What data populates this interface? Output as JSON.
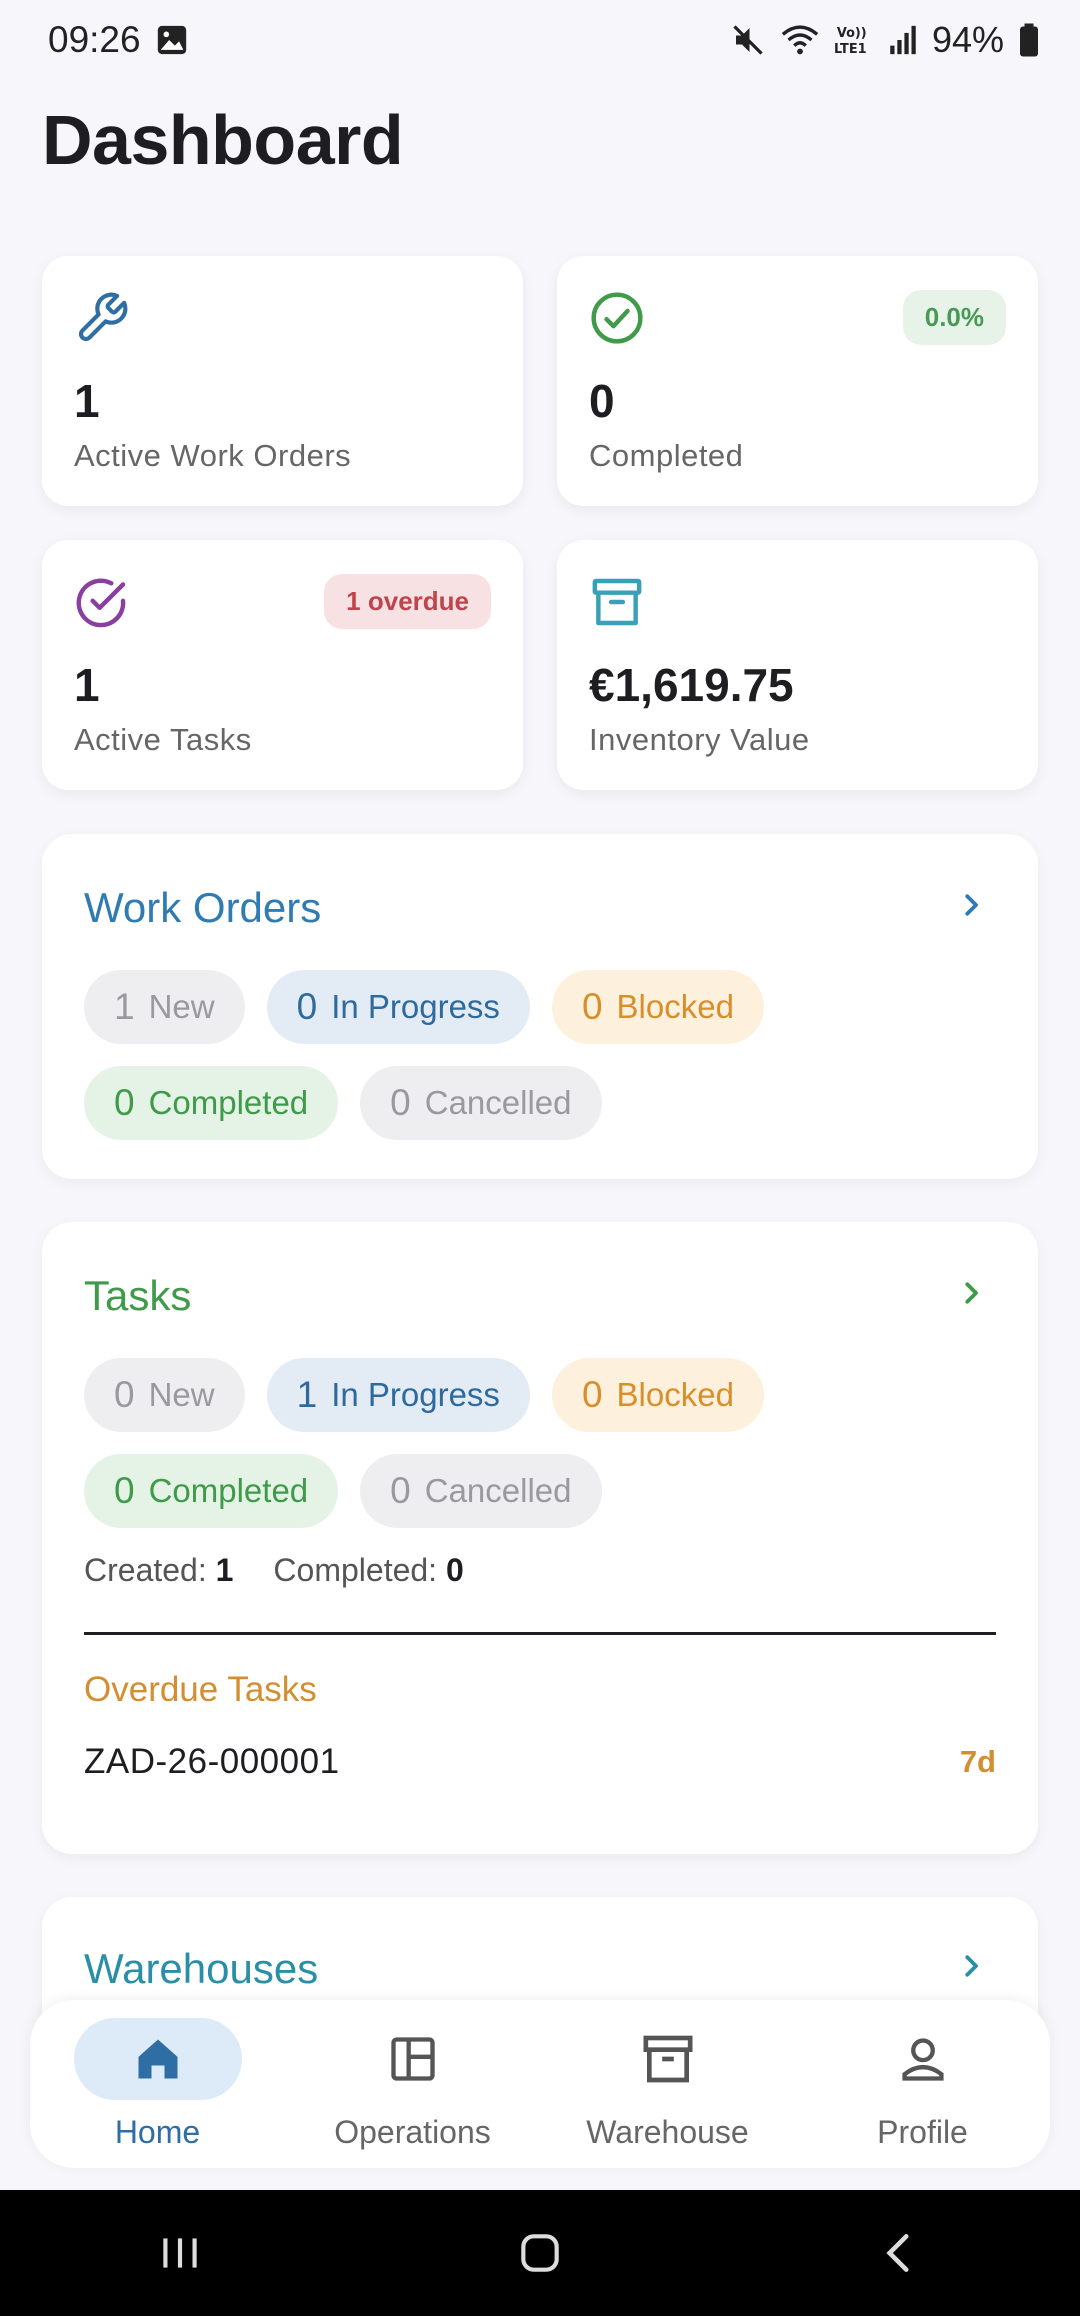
{
  "status_bar": {
    "time": "09:26",
    "battery": "94%",
    "icons": [
      "gallery-icon",
      "mute-icon",
      "wifi-icon",
      "volte-icon",
      "signal-icon",
      "battery-icon"
    ]
  },
  "page": {
    "title": "Dashboard"
  },
  "stats": {
    "work_orders": {
      "icon": "wrench-icon",
      "value": "1",
      "label": "Active Work Orders",
      "color": "#2f6ea5"
    },
    "completed": {
      "icon": "check-circle-icon",
      "value": "0",
      "label": "Completed",
      "badge": "0.0%",
      "color": "#3f9a4a"
    },
    "tasks": {
      "icon": "task-check-icon",
      "value": "1",
      "label": "Active Tasks",
      "badge": "1 overdue",
      "color": "#8a3fa0"
    },
    "inventory": {
      "icon": "archive-icon",
      "value": "€1,619.75",
      "label": "Inventory Value",
      "color": "#3aa0b8"
    }
  },
  "work_orders_section": {
    "title": "Work Orders",
    "color": "#2f7bb3",
    "chips": [
      {
        "num": "1",
        "label": "New",
        "style": "gray"
      },
      {
        "num": "0",
        "label": "In Progress",
        "style": "blue"
      },
      {
        "num": "0",
        "label": "Blocked",
        "style": "orange"
      },
      {
        "num": "0",
        "label": "Completed",
        "style": "green"
      },
      {
        "num": "0",
        "label": "Cancelled",
        "style": "gray"
      }
    ]
  },
  "tasks_section": {
    "title": "Tasks",
    "color": "#3f9a4a",
    "chips": [
      {
        "num": "0",
        "label": "New",
        "style": "gray"
      },
      {
        "num": "1",
        "label": "In Progress",
        "style": "blue"
      },
      {
        "num": "0",
        "label": "Blocked",
        "style": "orange"
      },
      {
        "num": "0",
        "label": "Completed",
        "style": "green"
      },
      {
        "num": "0",
        "label": "Cancelled",
        "style": "gray"
      }
    ],
    "created_label": "Created:",
    "created_value": "1",
    "completed_label": "Completed:",
    "completed_value": "0",
    "overdue_title": "Overdue Tasks",
    "overdue_items": [
      {
        "id": "ZAD-26-000001",
        "days": "7d"
      }
    ]
  },
  "warehouses_section": {
    "title": "Warehouses",
    "color": "#2a8fa6"
  },
  "bottom_nav": {
    "items": [
      {
        "label": "Home",
        "icon": "home-icon",
        "active": true
      },
      {
        "label": "Operations",
        "icon": "operations-icon",
        "active": false
      },
      {
        "label": "Warehouse",
        "icon": "archive-icon",
        "active": false
      },
      {
        "label": "Profile",
        "icon": "person-icon",
        "active": false
      }
    ]
  },
  "system_nav": {
    "icons": [
      "recents-icon",
      "home-button-icon",
      "back-icon"
    ]
  }
}
